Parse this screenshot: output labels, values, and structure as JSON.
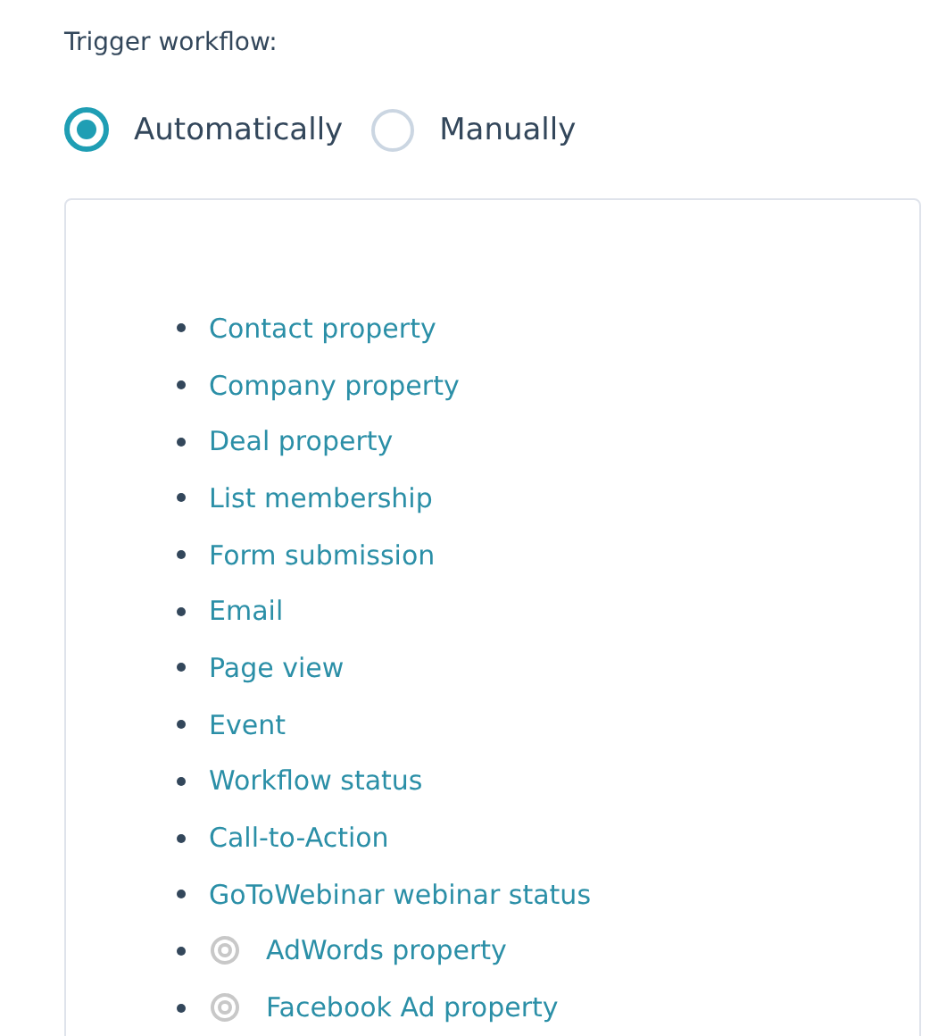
{
  "trigger": {
    "label": "Trigger workflow:",
    "options": [
      {
        "label": "Automatically",
        "selected": true
      },
      {
        "label": "Manually",
        "selected": false
      }
    ]
  },
  "triggers": [
    {
      "kind": "link",
      "label": "Contact property"
    },
    {
      "kind": "link",
      "label": "Company property"
    },
    {
      "kind": "link",
      "label": "Deal property"
    },
    {
      "kind": "link",
      "label": "List membership"
    },
    {
      "kind": "link",
      "label": "Form submission"
    },
    {
      "kind": "link",
      "label": "Email"
    },
    {
      "kind": "link",
      "label": "Page view"
    },
    {
      "kind": "link",
      "label": "Event"
    },
    {
      "kind": "link",
      "label": "Workflow status"
    },
    {
      "kind": "link",
      "label": "Call-to-Action"
    },
    {
      "kind": "link",
      "label": "GoToWebinar webinar status"
    },
    {
      "kind": "target",
      "label": "AdWords property"
    },
    {
      "kind": "target",
      "label": "Facebook Ad property"
    }
  ]
}
